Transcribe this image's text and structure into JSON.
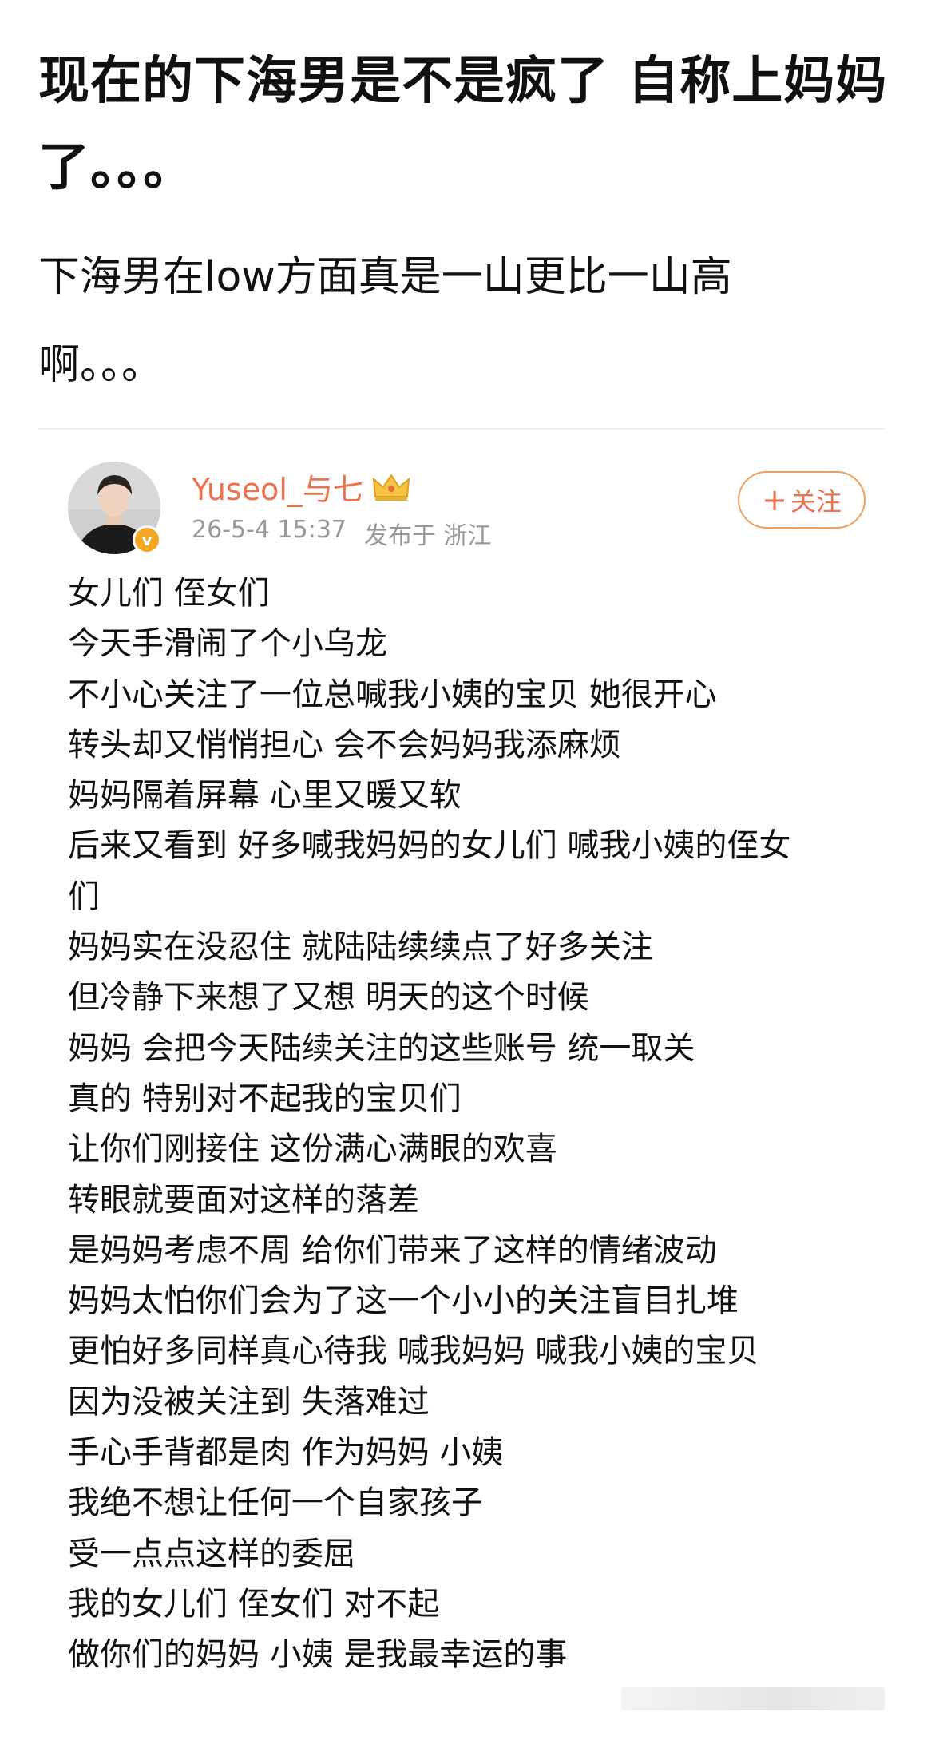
{
  "post": {
    "title_lines": [
      "现在的下海男是不是疯了 自称上妈妈",
      "了。。。"
    ],
    "description_lines": [
      "下海男在low方面真是一山更比一山高",
      "啊。。。"
    ]
  },
  "embedded_post": {
    "username": "Yuseol_与七",
    "timestamp": "26-5-4 15:37",
    "location": "发布于 浙江",
    "follow_label": "关注",
    "follow_plus": "+",
    "verified_badge": "v",
    "body_lines": [
      "女儿们 侄女们",
      "今天手滑闹了个小乌龙",
      "不小心关注了一位总喊我小姨的宝贝 她很开心",
      "转头却又悄悄担心 会不会妈妈我添麻烦",
      "妈妈隔着屏幕 心里又暖又软",
      "后来又看到 好多喊我妈妈的女儿们 喊我小姨的侄女",
      "们",
      "妈妈实在没忍住 就陆陆续续点了好多关注",
      "但冷静下来想了又想 明天的这个时候",
      "妈妈 会把今天陆续关注的这些账号 统一取关",
      "真的 特别对不起我的宝贝们",
      "让你们刚接住 这份满心满眼的欢喜",
      "转眼就要面对这样的落差",
      "是妈妈考虑不周 给你们带来了这样的情绪波动",
      "妈妈太怕你们会为了这一个小小的关注盲目扎堆",
      "更怕好多同样真心待我 喊我妈妈 喊我小姨的宝贝",
      "因为没被关注到 失落难过",
      "手心手背都是肉 作为妈妈 小姨",
      "我绝不想让任何一个自家孩子",
      "受一点点这样的委屈",
      "我的女儿们 侄女们 对不起",
      "做你们的妈妈 小姨 是我最幸运的事"
    ]
  },
  "icons": {
    "avatar": "avatar-photo",
    "badge": "verified-badge-icon",
    "crown": "crown-icon"
  },
  "colors": {
    "username": "#eb7350",
    "meta": "#999999",
    "follow_border": "#f0a060",
    "badge": "#f5a623"
  }
}
